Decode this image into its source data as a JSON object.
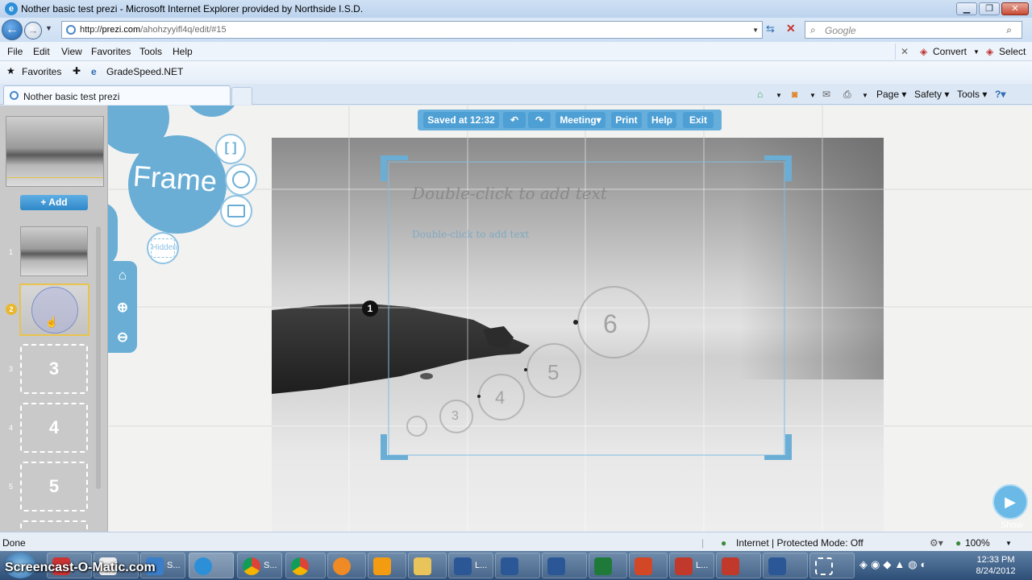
{
  "window": {
    "title": "Nother basic test prezi - Microsoft Internet Explorer provided by Northside I.S.D."
  },
  "address": {
    "scheme": "http://",
    "host": "prezi.com",
    "path": "/ahohzyyifl4q/edit/#15"
  },
  "search": {
    "placeholder": "Google"
  },
  "menu": [
    "File",
    "Edit",
    "View",
    "Favorites",
    "Tools",
    "Help"
  ],
  "menu_right": {
    "convert": "Convert",
    "select": "Select"
  },
  "favorites": {
    "label": "Favorites",
    "gradespeed": "GradeSpeed.NET"
  },
  "tab": {
    "label": "Nother basic test prezi"
  },
  "commandbar": {
    "page": "Page",
    "safety": "Safety",
    "tools": "Tools"
  },
  "prezi": {
    "add_label": "Add",
    "toolbar": {
      "saved": "Saved at 12:32",
      "meeting": "Meeting",
      "print": "Print",
      "help": "Help",
      "exit": "Exit"
    },
    "frame_label": "Frame",
    "hidden_label": "Hidden",
    "path_items": [
      "1",
      "2",
      "3",
      "4",
      "5"
    ],
    "thumb_labels": {
      "three": "3",
      "four": "4",
      "five": "5"
    },
    "frame_title": "Double-click to add text",
    "frame_body": "Double-click to add text",
    "path_step_badge": "1",
    "path_circles": [
      "6",
      "5",
      "4",
      "3"
    ],
    "show_label": "Show"
  },
  "status": {
    "left": "Done",
    "zone": "Internet | Protected Mode: Off",
    "zoom": "100%"
  },
  "taskbar": {
    "watermark": "Screencast-O-Matic.com",
    "clock_time": "12:33 PM",
    "clock_date": "8/24/2012",
    "short_label": "S...",
    "short_label_l": "L..."
  }
}
